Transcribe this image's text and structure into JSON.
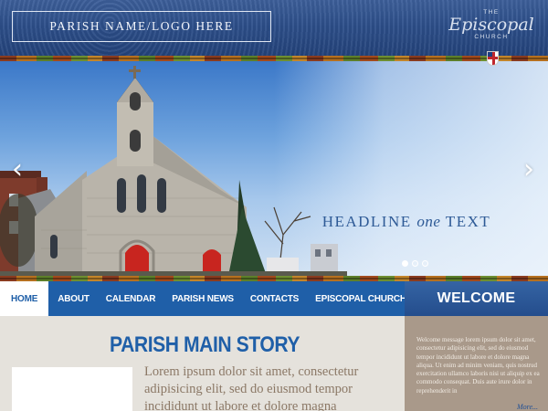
{
  "header": {
    "logo_placeholder": "PARISH NAME/LOGO HERE",
    "brand_the": "THE",
    "brand_name": "Episcopal",
    "brand_church": "CHURCH"
  },
  "hero": {
    "headline_before": "HEADLINE ",
    "headline_em": "one",
    "headline_after": " TEXT",
    "prev_arrow": "‹",
    "next_arrow": "›",
    "slides": 3,
    "active_slide": 1
  },
  "nav": {
    "items": [
      {
        "label": "HOME",
        "active": true
      },
      {
        "label": "ABOUT"
      },
      {
        "label": "CALENDAR"
      },
      {
        "label": "PARISH NEWS"
      },
      {
        "label": "CONTACTS"
      },
      {
        "label": "EPISCOPAL CHURCH NEWS"
      }
    ]
  },
  "main": {
    "story_title": "PARISH MAIN STORY",
    "story_body": "Lorem ipsum dolor sit amet, consectetur adipisicing elit, sed do eiusmod tempor incididunt ut labore et dolore magna"
  },
  "sidebar": {
    "title": "WELCOME",
    "text": "Welcome message lorem ipsum dolor sit amet, consectetur adipisicing elit, sed do eiusmod tempor incididunt ut labore et dolore magna aliqua. Ut enim ad minim veniam, quis nostrud exercitation ullamco laboris nisi ut aliquip ex ea commodo consequat. Duis aute irure dolor in reprehenderit in",
    "more": "More..."
  },
  "colors": {
    "nav_blue": "#1f5fa8",
    "headline_blue": "#2e5a96",
    "sidebar_bg": "#a9998a"
  }
}
